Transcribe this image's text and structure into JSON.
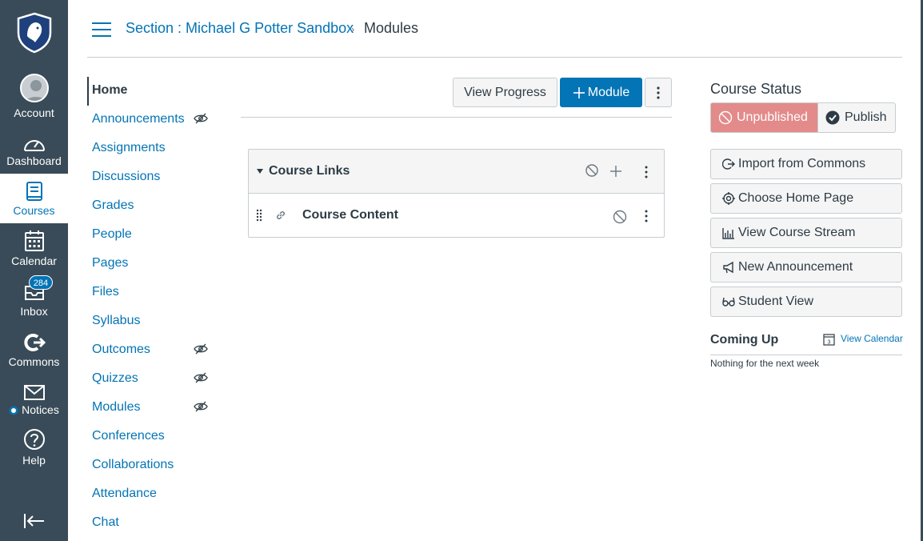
{
  "global_nav": {
    "account": "Account",
    "dashboard": "Dashboard",
    "courses": "Courses",
    "calendar": "Calendar",
    "inbox": "Inbox",
    "inbox_badge": "284",
    "commons": "Commons",
    "notices": "Notices",
    "help": "Help"
  },
  "breadcrumb": {
    "section": "Section : Michael G Potter Sandbox",
    "separator": "›",
    "current": "Modules"
  },
  "course_nav": {
    "items": [
      {
        "label": "Home"
      },
      {
        "label": "Announcements"
      },
      {
        "label": "Assignments"
      },
      {
        "label": "Discussions"
      },
      {
        "label": "Grades"
      },
      {
        "label": "People"
      },
      {
        "label": "Pages"
      },
      {
        "label": "Files"
      },
      {
        "label": "Syllabus"
      },
      {
        "label": "Outcomes"
      },
      {
        "label": "Quizzes"
      },
      {
        "label": "Modules"
      },
      {
        "label": "Conferences"
      },
      {
        "label": "Collaborations"
      },
      {
        "label": "Attendance"
      },
      {
        "label": "Chat"
      }
    ]
  },
  "toolbar": {
    "view_progress": "View Progress",
    "add_module": "Module"
  },
  "module": {
    "title": "Course Links",
    "items": [
      {
        "title": "Course Content"
      }
    ]
  },
  "sidebar": {
    "course_status_heading": "Course Status",
    "unpublished": "Unpublished",
    "publish": "Publish",
    "buttons": [
      {
        "label": "Import from Commons",
        "icon": "import-icon"
      },
      {
        "label": "Choose Home Page",
        "icon": "target-icon"
      },
      {
        "label": "View Course Stream",
        "icon": "stream-icon"
      },
      {
        "label": "New Announcement",
        "icon": "megaphone-icon"
      },
      {
        "label": "Student View",
        "icon": "glasses-icon"
      }
    ],
    "coming_up": "Coming Up",
    "view_calendar": "View Calendar",
    "calendar_icon_digit": "3",
    "coming_up_empty": "Nothing for the next week"
  },
  "colors": {
    "nav_bg": "#394b58",
    "link": "#0374b5",
    "unpublished": "#e38a8a"
  }
}
